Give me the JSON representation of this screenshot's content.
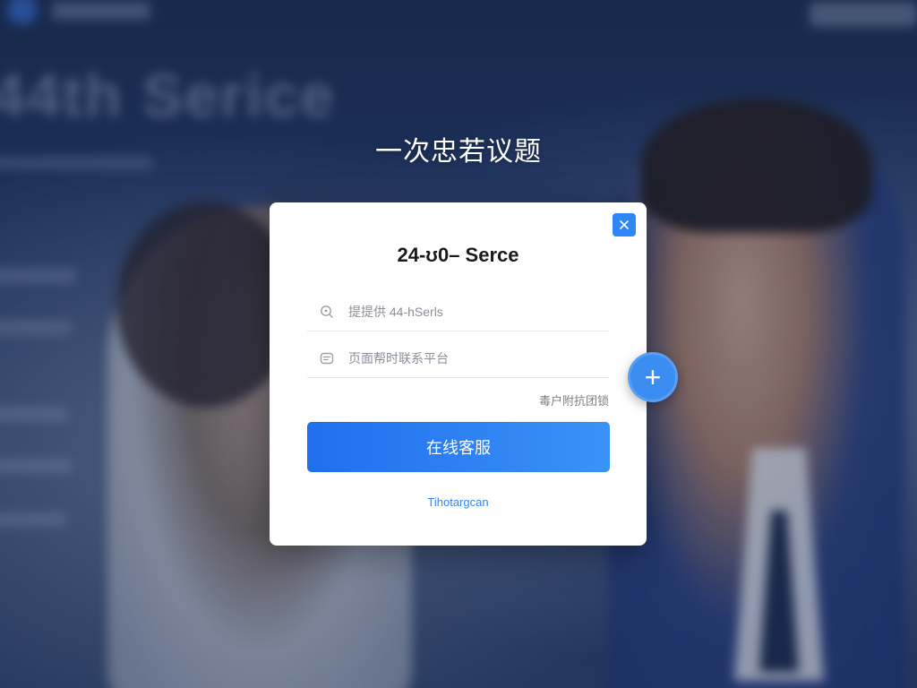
{
  "background": {
    "headline": "44th Serice"
  },
  "page_title": "一次忠若议题",
  "dialog": {
    "title": "24-ʊ0– Serce",
    "close_icon": "close-icon",
    "fields": [
      {
        "placeholder": "提提供 44-hSerls",
        "icon": "search-icon"
      },
      {
        "placeholder": "页面帮时联系平台",
        "icon": "chat-icon"
      }
    ],
    "forgot_label": "毒户附抗团锁",
    "primary_button": "在线客服",
    "footer_link": "Tihotargcan"
  },
  "fab": {
    "label": "+",
    "icon": "plus-icon"
  },
  "colors": {
    "accent": "#2f86f6",
    "button_gradient_start": "#1f6fee",
    "button_gradient_end": "#3b92f7",
    "background_dark": "#1c2d50"
  }
}
